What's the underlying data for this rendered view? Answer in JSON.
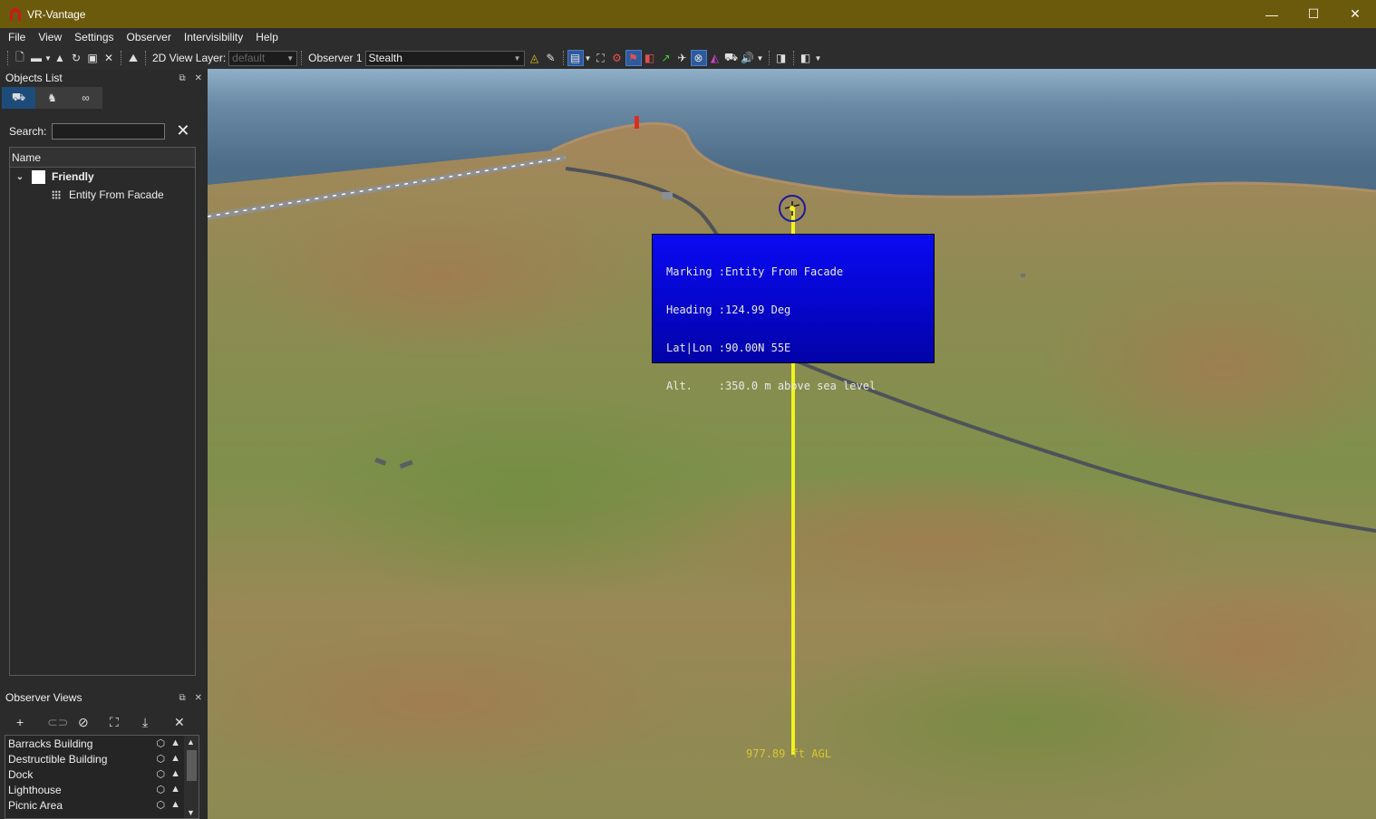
{
  "window": {
    "title": "VR-Vantage",
    "minimize": "—",
    "maximize": "☐",
    "close": "✕"
  },
  "menu": [
    "File",
    "View",
    "Settings",
    "Observer",
    "Intervisibility",
    "Help"
  ],
  "toolbar": {
    "view_layer_label": "2D View Layer:",
    "view_layer_value": "default",
    "observer_label": "Observer 1",
    "observer_value": "Stealth"
  },
  "objects_list": {
    "title": "Objects List",
    "search_label": "Search:",
    "search_value": "",
    "column_header": "Name",
    "tree": [
      {
        "label": "Friendly",
        "expanded": true,
        "checked": false
      },
      {
        "label": "Entity From Facade"
      }
    ]
  },
  "observer_views": {
    "title": "Observer Views",
    "items": [
      "Barracks Building",
      "Destructible Building",
      "Dock",
      "Lighthouse",
      "Picnic Area"
    ]
  },
  "viewport": {
    "info_lines": [
      "Marking :Entity From Facade",
      "Heading :124.99 Deg",
      "Lat|Lon :90.00N 55E",
      "Alt.    :350.0 m above sea level"
    ],
    "agl_label": "977.89 ft AGL"
  },
  "colors": {
    "titlebar": "#6b5a0c",
    "info_box": "#0a0af2",
    "pole": "#f2f21c"
  }
}
